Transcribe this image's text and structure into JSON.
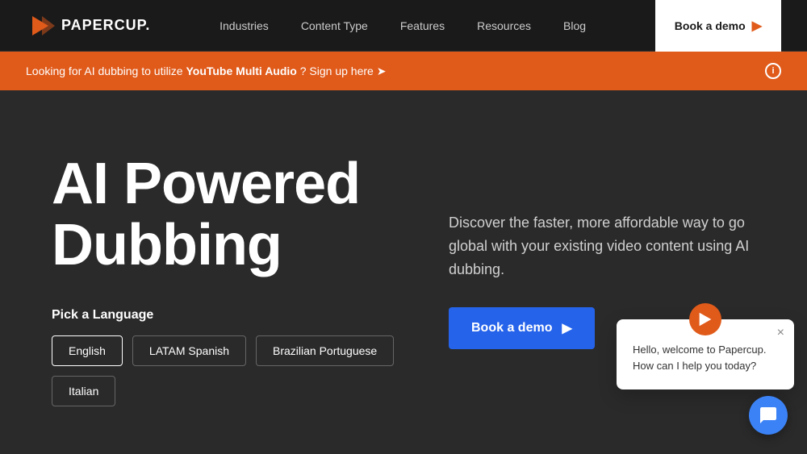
{
  "nav": {
    "logo_text": "PAPERCUP.",
    "links": [
      {
        "label": "Industries",
        "id": "industries"
      },
      {
        "label": "Content Type",
        "id": "content-type"
      },
      {
        "label": "Features",
        "id": "features"
      },
      {
        "label": "Resources",
        "id": "resources"
      },
      {
        "label": "Blog",
        "id": "blog"
      }
    ],
    "book_demo_label": "Book a demo"
  },
  "banner": {
    "prefix": "Looking for AI dubbing to utilize",
    "highlight": "YouTube Multi Audio",
    "suffix": "? Sign up here ➤"
  },
  "hero": {
    "title": "AI Powered Dubbing",
    "description": "Discover the faster, more affordable way to go global with your existing video content using AI dubbing.",
    "book_demo_label": "Book a demo",
    "pick_language_label": "Pick a Language",
    "languages": [
      {
        "label": "English",
        "active": true
      },
      {
        "label": "LATAM Spanish",
        "active": false
      },
      {
        "label": "Brazilian Portuguese",
        "active": false
      },
      {
        "label": "Italian",
        "active": false
      }
    ]
  },
  "chat": {
    "popup_text": "Hello, welcome to Papercup. How can I help you today?",
    "close_label": "×"
  }
}
